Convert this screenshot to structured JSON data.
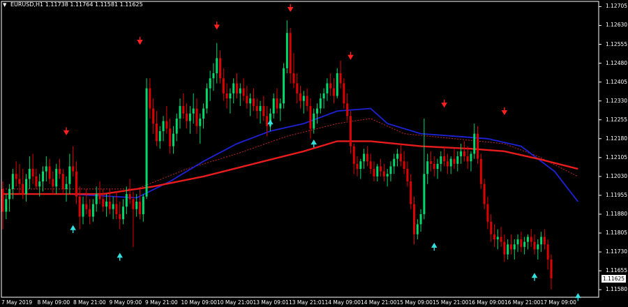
{
  "header": {
    "symbol": "EURUSD,H1",
    "ohlc": "1.11738 1.11764 1.11581 1.11625"
  },
  "current_price": "1.11625",
  "colors": {
    "background": "#000000",
    "bull_candle": "#00d96c",
    "bear_candle": "#e00000",
    "ma_blue": "#1e22d6",
    "ma_red": "#e81c1c",
    "ma_dotted": "#c62828",
    "ma_grey": "#8a8a8a",
    "arrow_up": "#32e0e0",
    "arrow_down": "#ff2020",
    "axis": "#ffffff"
  },
  "chart_data": {
    "type": "candlestick",
    "title": "EURUSD,H1",
    "ylim": [
      1.1155,
      1.1272
    ],
    "y_ticks": [
      "1.12705",
      "1.12630",
      "1.12555",
      "1.12480",
      "1.12405",
      "1.12330",
      "1.12255",
      "1.12180",
      "1.12105",
      "1.12030",
      "1.11955",
      "1.11880",
      "1.11805",
      "1.11730",
      "1.11655",
      "1.11580"
    ],
    "x_ticks": [
      "7 May 2019",
      "8 May 09:00",
      "8 May 21:00",
      "9 May 09:00",
      "9 May 21:00",
      "10 May 09:00",
      "10 May 21:00",
      "13 May 09:01",
      "13 May 21:01",
      "14 May 09:00",
      "14 May 21:00",
      "15 May 09:00",
      "15 May 21:00",
      "16 May 09:00",
      "16 May 21:00",
      "17 May 09:00"
    ],
    "candles": [
      [
        1.1198,
        1.1201,
        1.1182,
        1.1189
      ],
      [
        1.1189,
        1.1196,
        1.1186,
        1.1194
      ],
      [
        1.1194,
        1.12,
        1.1189,
        1.1198
      ],
      [
        1.1198,
        1.1206,
        1.1194,
        1.1204
      ],
      [
        1.1204,
        1.1209,
        1.1199,
        1.1202
      ],
      [
        1.1202,
        1.1208,
        1.1196,
        1.12
      ],
      [
        1.12,
        1.1206,
        1.1194,
        1.1196
      ],
      [
        1.1196,
        1.1204,
        1.1193,
        1.1202
      ],
      [
        1.1202,
        1.1211,
        1.1198,
        1.1206
      ],
      [
        1.1206,
        1.1212,
        1.12,
        1.1203
      ],
      [
        1.1203,
        1.1206,
        1.1198,
        1.1199
      ],
      [
        1.1199,
        1.1204,
        1.1195,
        1.1201
      ],
      [
        1.1201,
        1.1207,
        1.1197,
        1.1205
      ],
      [
        1.1205,
        1.1211,
        1.1201,
        1.1207
      ],
      [
        1.1207,
        1.121,
        1.12,
        1.1202
      ],
      [
        1.1202,
        1.1205,
        1.1196,
        1.1199
      ],
      [
        1.1199,
        1.1208,
        1.1196,
        1.1206
      ],
      [
        1.1206,
        1.121,
        1.1202,
        1.1204
      ],
      [
        1.1204,
        1.1206,
        1.1196,
        1.1198
      ],
      [
        1.1198,
        1.1203,
        1.1193,
        1.12
      ],
      [
        1.12,
        1.1212,
        1.1196,
        1.1207
      ],
      [
        1.1207,
        1.1215,
        1.1203,
        1.1205
      ],
      [
        1.1205,
        1.1209,
        1.1192,
        1.1195
      ],
      [
        1.1195,
        1.1199,
        1.1182,
        1.1187
      ],
      [
        1.1187,
        1.1195,
        1.1184,
        1.1192
      ],
      [
        1.1192,
        1.1198,
        1.1188,
        1.119
      ],
      [
        1.119,
        1.1194,
        1.1184,
        1.1187
      ],
      [
        1.1187,
        1.1194,
        1.1185,
        1.1192
      ],
      [
        1.1192,
        1.1199,
        1.1189,
        1.1196
      ],
      [
        1.1196,
        1.1201,
        1.1192,
        1.1194
      ],
      [
        1.1194,
        1.1198,
        1.1189,
        1.1191
      ],
      [
        1.1191,
        1.1196,
        1.1187,
        1.1193
      ],
      [
        1.1193,
        1.1198,
        1.1188,
        1.119
      ],
      [
        1.119,
        1.1195,
        1.1186,
        1.1192
      ],
      [
        1.1192,
        1.1197,
        1.1186,
        1.1188
      ],
      [
        1.1188,
        1.1193,
        1.1182,
        1.1186
      ],
      [
        1.1186,
        1.1194,
        1.1184,
        1.1191
      ],
      [
        1.1191,
        1.1199,
        1.1188,
        1.1196
      ],
      [
        1.1196,
        1.1202,
        1.1192,
        1.1194
      ],
      [
        1.1194,
        1.1197,
        1.1175,
        1.119
      ],
      [
        1.119,
        1.1196,
        1.1187,
        1.1193
      ],
      [
        1.1193,
        1.1198,
        1.1186,
        1.1188
      ],
      [
        1.1188,
        1.1196,
        1.1185,
        1.1195
      ],
      [
        1.1195,
        1.1242,
        1.1194,
        1.1238
      ],
      [
        1.1238,
        1.1242,
        1.1226,
        1.123
      ],
      [
        1.123,
        1.1234,
        1.122,
        1.1224
      ],
      [
        1.1224,
        1.1229,
        1.1215,
        1.1217
      ],
      [
        1.1217,
        1.1223,
        1.1214,
        1.1221
      ],
      [
        1.1221,
        1.1227,
        1.1217,
        1.1225
      ],
      [
        1.1225,
        1.1231,
        1.122,
        1.1222
      ],
      [
        1.1222,
        1.1226,
        1.1212,
        1.1215
      ],
      [
        1.1215,
        1.1223,
        1.1212,
        1.122
      ],
      [
        1.122,
        1.1228,
        1.1217,
        1.1226
      ],
      [
        1.1226,
        1.1234,
        1.1222,
        1.1231
      ],
      [
        1.1231,
        1.1236,
        1.1226,
        1.1228
      ],
      [
        1.1228,
        1.1232,
        1.1222,
        1.1225
      ],
      [
        1.1225,
        1.1231,
        1.122,
        1.1228
      ],
      [
        1.1228,
        1.1236,
        1.1224,
        1.123
      ],
      [
        1.123,
        1.1234,
        1.122,
        1.1223
      ],
      [
        1.1223,
        1.1228,
        1.1216,
        1.1226
      ],
      [
        1.1226,
        1.1232,
        1.1222,
        1.123
      ],
      [
        1.123,
        1.124,
        1.1228,
        1.1238
      ],
      [
        1.1238,
        1.1245,
        1.1233,
        1.1242
      ],
      [
        1.1242,
        1.1248,
        1.1237,
        1.1244
      ],
      [
        1.1244,
        1.1256,
        1.124,
        1.125
      ],
      [
        1.125,
        1.1253,
        1.124,
        1.1242
      ],
      [
        1.1242,
        1.1246,
        1.1233,
        1.1236
      ],
      [
        1.1236,
        1.124,
        1.123,
        1.1234
      ],
      [
        1.1234,
        1.1238,
        1.1228,
        1.1236
      ],
      [
        1.1236,
        1.1242,
        1.1232,
        1.124
      ],
      [
        1.124,
        1.1244,
        1.1234,
        1.1236
      ],
      [
        1.1236,
        1.124,
        1.1231,
        1.1238
      ],
      [
        1.1238,
        1.1242,
        1.1233,
        1.1235
      ],
      [
        1.1235,
        1.1239,
        1.123,
        1.1232
      ],
      [
        1.1232,
        1.1236,
        1.1227,
        1.1234
      ],
      [
        1.1234,
        1.1238,
        1.1229,
        1.1231
      ],
      [
        1.1231,
        1.1234,
        1.1226,
        1.1229
      ],
      [
        1.1229,
        1.1233,
        1.1224,
        1.1231
      ],
      [
        1.1231,
        1.1235,
        1.1225,
        1.1227
      ],
      [
        1.1227,
        1.1231,
        1.1219,
        1.1223
      ],
      [
        1.1223,
        1.123,
        1.1221,
        1.1228
      ],
      [
        1.1228,
        1.1236,
        1.1226,
        1.1234
      ],
      [
        1.1234,
        1.1238,
        1.1228,
        1.123
      ],
      [
        1.123,
        1.1234,
        1.1225,
        1.1232
      ],
      [
        1.1232,
        1.1248,
        1.123,
        1.1246
      ],
      [
        1.1246,
        1.1265,
        1.1244,
        1.126
      ],
      [
        1.126,
        1.1262,
        1.124,
        1.1244
      ],
      [
        1.1244,
        1.1252,
        1.1238,
        1.124
      ],
      [
        1.124,
        1.1244,
        1.1232,
        1.1236
      ],
      [
        1.1236,
        1.1239,
        1.123,
        1.1233
      ],
      [
        1.1233,
        1.1237,
        1.1228,
        1.1235
      ],
      [
        1.1235,
        1.1238,
        1.1229,
        1.1231
      ],
      [
        1.1231,
        1.1234,
        1.1218,
        1.1222
      ],
      [
        1.1222,
        1.123,
        1.122,
        1.1228
      ],
      [
        1.1228,
        1.1232,
        1.1224,
        1.123
      ],
      [
        1.123,
        1.1236,
        1.1228,
        1.1234
      ],
      [
        1.1234,
        1.1238,
        1.123,
        1.1236
      ],
      [
        1.1236,
        1.1242,
        1.1233,
        1.124
      ],
      [
        1.124,
        1.1244,
        1.1235,
        1.1238
      ],
      [
        1.1238,
        1.1242,
        1.1232,
        1.1235
      ],
      [
        1.1235,
        1.1246,
        1.1234,
        1.1244
      ],
      [
        1.1244,
        1.1249,
        1.1238,
        1.124
      ],
      [
        1.124,
        1.1242,
        1.123,
        1.1232
      ],
      [
        1.1232,
        1.1236,
        1.1225,
        1.1227
      ],
      [
        1.1227,
        1.1229,
        1.1212,
        1.1215
      ],
      [
        1.1215,
        1.1216,
        1.1204,
        1.1208
      ],
      [
        1.1208,
        1.1211,
        1.1203,
        1.1206
      ],
      [
        1.1206,
        1.121,
        1.1202,
        1.1209
      ],
      [
        1.1209,
        1.1214,
        1.1206,
        1.1212
      ],
      [
        1.1212,
        1.1215,
        1.1207,
        1.1209
      ],
      [
        1.1209,
        1.1212,
        1.1204,
        1.1206
      ],
      [
        1.1206,
        1.1209,
        1.1201,
        1.1203
      ],
      [
        1.1203,
        1.1208,
        1.1201,
        1.1207
      ],
      [
        1.1207,
        1.121,
        1.1203,
        1.1205
      ],
      [
        1.1205,
        1.1208,
        1.1201,
        1.1203
      ],
      [
        1.1203,
        1.1206,
        1.1199,
        1.1204
      ],
      [
        1.1204,
        1.1209,
        1.1201,
        1.1207
      ],
      [
        1.1207,
        1.1212,
        1.1204,
        1.121
      ],
      [
        1.121,
        1.1214,
        1.1207,
        1.1212
      ],
      [
        1.1212,
        1.1216,
        1.1207,
        1.1209
      ],
      [
        1.1209,
        1.1213,
        1.1204,
        1.1206
      ],
      [
        1.1206,
        1.1209,
        1.1199,
        1.1201
      ],
      [
        1.1201,
        1.1204,
        1.119,
        1.1192
      ],
      [
        1.1192,
        1.1195,
        1.1176,
        1.118
      ],
      [
        1.118,
        1.1186,
        1.1178,
        1.1184
      ],
      [
        1.1184,
        1.119,
        1.1181,
        1.1188
      ],
      [
        1.1188,
        1.1226,
        1.1186,
        1.1204
      ],
      [
        1.1204,
        1.1212,
        1.12,
        1.1209
      ],
      [
        1.1209,
        1.1213,
        1.1205,
        1.1208
      ],
      [
        1.1208,
        1.1211,
        1.1203,
        1.1206
      ],
      [
        1.1206,
        1.121,
        1.1202,
        1.1208
      ],
      [
        1.1208,
        1.1213,
        1.1205,
        1.1211
      ],
      [
        1.1211,
        1.1215,
        1.1207,
        1.1209
      ],
      [
        1.1209,
        1.1212,
        1.1204,
        1.1207
      ],
      [
        1.1207,
        1.1211,
        1.1204,
        1.121
      ],
      [
        1.121,
        1.1214,
        1.1206,
        1.1208
      ],
      [
        1.1208,
        1.1213,
        1.1205,
        1.1211
      ],
      [
        1.1211,
        1.1216,
        1.1208,
        1.1213
      ],
      [
        1.1213,
        1.1217,
        1.1209,
        1.1211
      ],
      [
        1.1211,
        1.1215,
        1.1206,
        1.1209
      ],
      [
        1.1209,
        1.1213,
        1.1205,
        1.1212
      ],
      [
        1.1212,
        1.1224,
        1.121,
        1.122
      ],
      [
        1.122,
        1.1223,
        1.1208,
        1.121
      ],
      [
        1.121,
        1.1212,
        1.1198,
        1.12
      ],
      [
        1.12,
        1.1202,
        1.119,
        1.1192
      ],
      [
        1.1192,
        1.1195,
        1.1182,
        1.1185
      ],
      [
        1.1185,
        1.1188,
        1.1177,
        1.118
      ],
      [
        1.118,
        1.1184,
        1.1175,
        1.1178
      ],
      [
        1.1178,
        1.1182,
        1.1174,
        1.1179
      ],
      [
        1.1179,
        1.1183,
        1.1175,
        1.1177
      ],
      [
        1.1177,
        1.118,
        1.1169,
        1.1172
      ],
      [
        1.1172,
        1.1178,
        1.117,
        1.1176
      ],
      [
        1.1176,
        1.118,
        1.1172,
        1.1174
      ],
      [
        1.1174,
        1.1178,
        1.117,
        1.1176
      ],
      [
        1.1176,
        1.118,
        1.1173,
        1.1178
      ],
      [
        1.1178,
        1.1181,
        1.1173,
        1.1175
      ],
      [
        1.1175,
        1.1179,
        1.1172,
        1.1177
      ],
      [
        1.1177,
        1.118,
        1.1174,
        1.1179
      ],
      [
        1.1179,
        1.1182,
        1.1175,
        1.1177
      ],
      [
        1.1177,
        1.118,
        1.1172,
        1.1174
      ],
      [
        1.1174,
        1.1178,
        1.117,
        1.1176
      ],
      [
        1.1176,
        1.1181,
        1.1173,
        1.1179
      ],
      [
        1.1179,
        1.1182,
        1.1174,
        1.1176
      ],
      [
        1.1176,
        1.1178,
        1.1166,
        1.117
      ],
      [
        1.117,
        1.1172,
        1.11581,
        1.11625
      ]
    ],
    "ma_blue": [
      [
        0,
        1.1196
      ],
      [
        20,
        1.1196
      ],
      [
        40,
        1.11945
      ],
      [
        50,
        1.1201
      ],
      [
        60,
        1.1209
      ],
      [
        70,
        1.1216
      ],
      [
        80,
        1.1221
      ],
      [
        90,
        1.1224
      ],
      [
        100,
        1.1229
      ],
      [
        110,
        1.123
      ],
      [
        115,
        1.1224
      ],
      [
        125,
        1.122
      ],
      [
        135,
        1.1219
      ],
      [
        145,
        1.1218
      ],
      [
        155,
        1.1215
      ],
      [
        165,
        1.1205
      ],
      [
        172,
        1.1193
      ]
    ],
    "ma_red": [
      [
        0,
        1.1196
      ],
      [
        30,
        1.1196
      ],
      [
        45,
        1.1199
      ],
      [
        60,
        1.1203
      ],
      [
        75,
        1.1208
      ],
      [
        90,
        1.1213
      ],
      [
        100,
        1.1217
      ],
      [
        110,
        1.1217
      ],
      [
        125,
        1.1215
      ],
      [
        140,
        1.1214
      ],
      [
        150,
        1.1213
      ],
      [
        160,
        1.121
      ],
      [
        172,
        1.1206
      ]
    ],
    "ma_dotted": [
      [
        0,
        1.1198
      ],
      [
        40,
        1.1198
      ],
      [
        55,
        1.1206
      ],
      [
        70,
        1.1212
      ],
      [
        85,
        1.1219
      ],
      [
        100,
        1.1224
      ],
      [
        110,
        1.1226
      ],
      [
        120,
        1.122
      ],
      [
        135,
        1.1218
      ],
      [
        150,
        1.1216
      ],
      [
        160,
        1.1211
      ],
      [
        172,
        1.1203
      ]
    ],
    "signals": [
      {
        "i": 19,
        "dir": "down",
        "price": 1.122
      },
      {
        "i": 21,
        "dir": "up",
        "price": 1.1183
      },
      {
        "i": 35,
        "dir": "up",
        "price": 1.1172
      },
      {
        "i": 41,
        "dir": "down",
        "price": 1.1256
      },
      {
        "i": 64,
        "dir": "down",
        "price": 1.1262
      },
      {
        "i": 80,
        "dir": "up",
        "price": 1.1225
      },
      {
        "i": 86,
        "dir": "down",
        "price": 1.1269
      },
      {
        "i": 93,
        "dir": "up",
        "price": 1.1217
      },
      {
        "i": 104,
        "dir": "down",
        "price": 1.125
      },
      {
        "i": 129,
        "dir": "up",
        "price": 1.1176
      },
      {
        "i": 132,
        "dir": "down",
        "price": 1.1231
      },
      {
        "i": 150,
        "dir": "down",
        "price": 1.1228
      },
      {
        "i": 159,
        "dir": "up",
        "price": 1.1164
      },
      {
        "i": 172,
        "dir": "up",
        "price": 1.1156
      }
    ]
  }
}
